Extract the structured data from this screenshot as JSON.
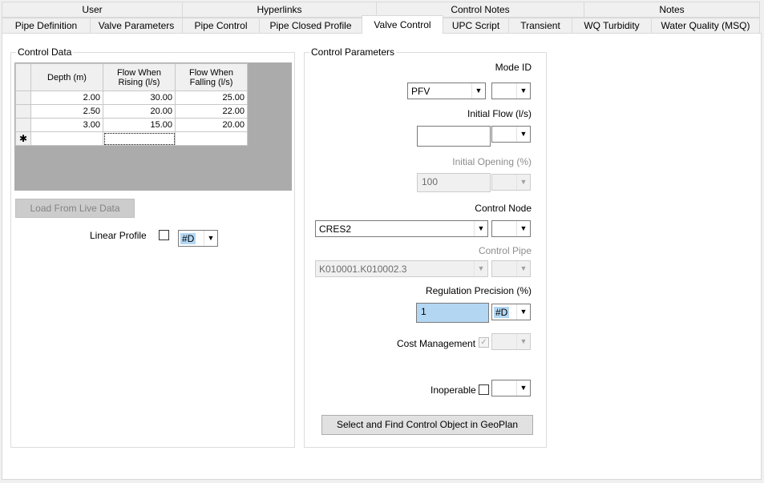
{
  "tabs": {
    "top": [
      "User",
      "Hyperlinks",
      "Control Notes",
      "Notes"
    ],
    "bottom": [
      "Pipe Definition",
      "Valve Parameters",
      "Pipe Control",
      "Pipe Closed Profile",
      "Valve Control",
      "UPC Script",
      "Transient",
      "WQ Turbidity",
      "Water Quality (MSQ)"
    ],
    "active": "Valve Control"
  },
  "control_data": {
    "title": "Control Data",
    "columns": [
      "Depth (m)",
      "Flow When Rising (l/s)",
      "Flow When Falling (l/s)"
    ],
    "rows": [
      [
        "2.00",
        "30.00",
        "25.00"
      ],
      [
        "2.50",
        "20.00",
        "22.00"
      ],
      [
        "3.00",
        "15.00",
        "20.00"
      ]
    ],
    "new_row_marker": "✱",
    "load_button": "Load From Live Data",
    "linear_profile_label": "Linear Profile",
    "linear_profile_combo": "#D"
  },
  "control_parameters": {
    "title": "Control Parameters",
    "mode_id_label": "Mode ID",
    "mode_id_value": "PFV",
    "initial_flow_label": "Initial Flow (l/s)",
    "initial_flow_value": "",
    "initial_opening_label": "Initial Opening (%)",
    "initial_opening_value": "100",
    "control_node_label": "Control Node",
    "control_node_value": "CRES2",
    "control_pipe_label": "Control Pipe",
    "control_pipe_value": "K010001.K010002.3",
    "regulation_precision_label": "Regulation Precision (%)",
    "regulation_precision_value": "1",
    "regulation_precision_flag": "#D",
    "cost_management_label": "Cost Management",
    "cost_management_check": "✓",
    "inoperable_label": "Inoperable",
    "select_button": "Select and Find Control Object in GeoPlan"
  },
  "icons": {
    "dropdown": "▼"
  }
}
